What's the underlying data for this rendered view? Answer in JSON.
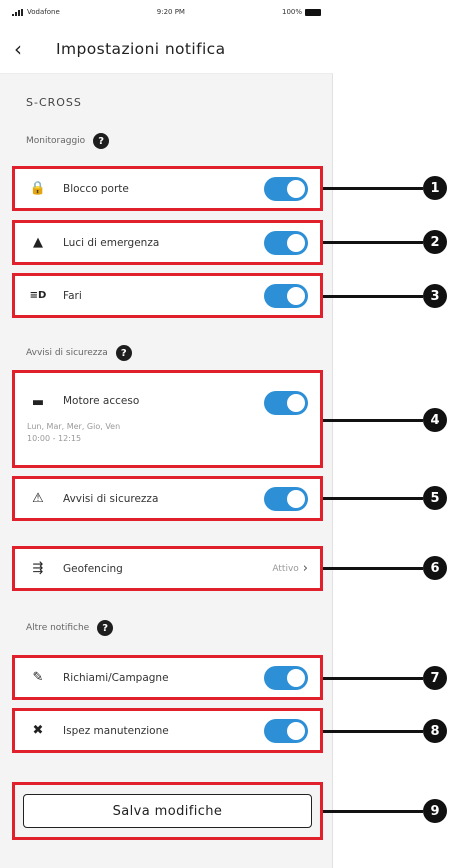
{
  "status_bar": {
    "carrier": "Vodafone",
    "time": "9:20 PM",
    "battery": "100%"
  },
  "header": {
    "back_glyph": "‹",
    "title": "Impostazioni notifica"
  },
  "car_name": "S-CROSS",
  "sections": {
    "monitoring": {
      "label": "Monitoraggio",
      "help": "?"
    },
    "security": {
      "label": "Avvisi di sicurezza",
      "help": "?"
    },
    "other": {
      "label": "Altre notifiche",
      "help": "?"
    }
  },
  "rows": {
    "door_lock": {
      "label": "Blocco porte",
      "icon": "lock-icon",
      "glyph": "🔒",
      "enabled": true
    },
    "hazard": {
      "label": "Luci di emergenza",
      "icon": "hazard-icon",
      "glyph": "▲",
      "enabled": true
    },
    "lights": {
      "label": "Fari",
      "icon": "headlight-icon",
      "glyph": "≡D",
      "enabled": true
    },
    "engine": {
      "label": "Motore acceso",
      "icon": "engine-icon",
      "glyph": "▬",
      "sub_days": "Lun, Mar, Mer, Gio, Ven",
      "sub_time": "10:00 - 12:15",
      "enabled": true
    },
    "security_alerts": {
      "label": "Avvisi di sicurezza",
      "icon": "alarm-car-icon",
      "glyph": "⚠",
      "enabled": true
    },
    "geofencing": {
      "label": "Geofencing",
      "icon": "geofence-car-icon",
      "glyph": "⇶",
      "value": "Attivo",
      "chevron": "›"
    },
    "recalls": {
      "label": "Richiami/Campagne",
      "icon": "recall-icon",
      "glyph": "✎",
      "enabled": true
    },
    "maintenance": {
      "label": "Ispez manutenzione",
      "icon": "tools-icon",
      "glyph": "✖",
      "enabled": true
    }
  },
  "save_button": {
    "label": "Salva modifiche"
  },
  "callouts": [
    "1",
    "2",
    "3",
    "4",
    "5",
    "6",
    "7",
    "8",
    "9"
  ],
  "colors": {
    "highlight": "#e0202a",
    "toggle_on": "#2d8fd5",
    "callout": "#111111"
  }
}
